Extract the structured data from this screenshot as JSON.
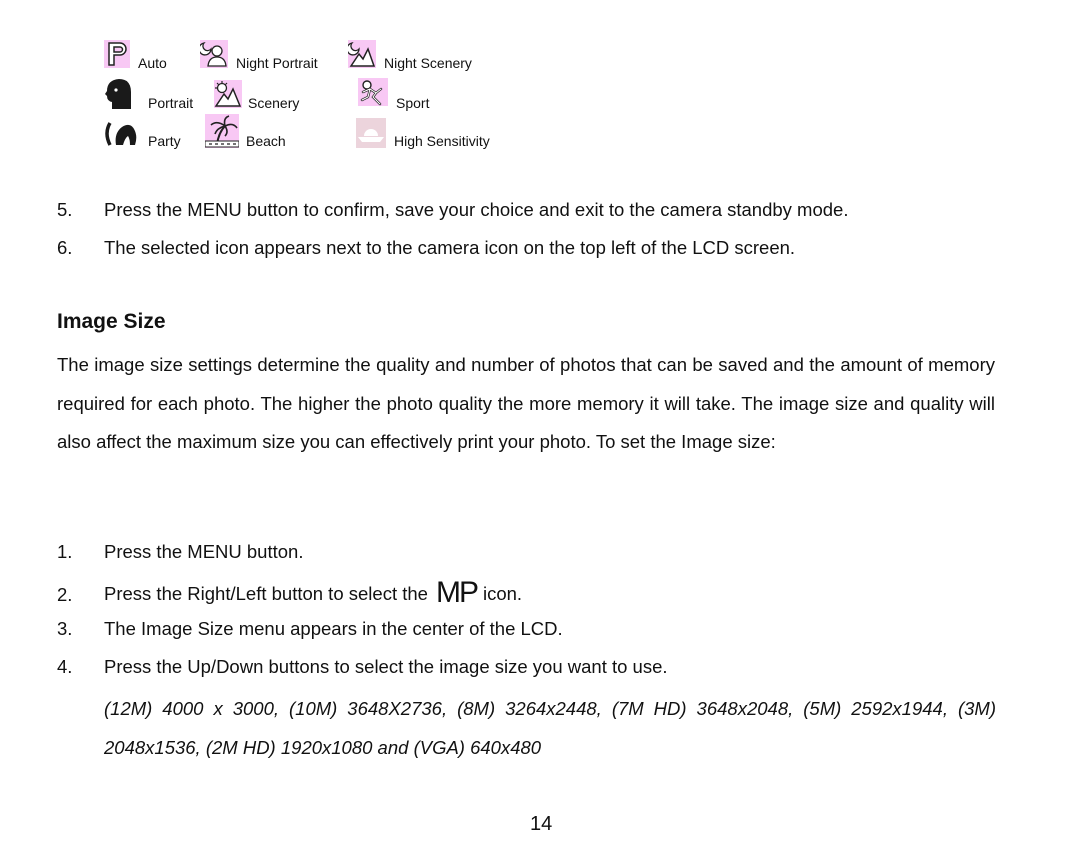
{
  "scene_modes": [
    {
      "label": "Auto",
      "icon": "auto-p-icon"
    },
    {
      "label": "Night Portrait",
      "icon": "night-portrait-icon"
    },
    {
      "label": "Night Scenery",
      "icon": "night-scenery-icon"
    },
    {
      "label": "Portrait",
      "icon": "portrait-icon"
    },
    {
      "label": "Scenery",
      "icon": "scenery-icon"
    },
    {
      "label": "Sport",
      "icon": "sport-icon"
    },
    {
      "label": "Party",
      "icon": "party-icon"
    },
    {
      "label": "Beach",
      "icon": "beach-icon"
    },
    {
      "label": "High Sensitivity",
      "icon": "high-sensitivity-icon"
    }
  ],
  "steps_continued": [
    {
      "num": "5.",
      "text": "Press the MENU button to confirm, save your choice and exit to the camera standby mode."
    },
    {
      "num": "6.",
      "text": "The selected icon appears next to the camera icon on the top left of the LCD screen."
    }
  ],
  "section": {
    "heading": "Image Size",
    "intro": "The image size settings determine the quality and number of photos that can be saved and the amount of memory required for each photo. The higher the photo quality the more memory it will take. The image size and quality will also affect the maximum size you can effectively print your photo. To set the Image size:",
    "steps": [
      {
        "num": "1.",
        "text": "Press the MENU button."
      },
      {
        "num": "2.",
        "text_before": "Press the Right/Left button to select the",
        "icon_text": "MP",
        "text_after": "icon."
      },
      {
        "num": "3.",
        "text": "The Image Size menu appears in the center of the LCD."
      },
      {
        "num": "4.",
        "text": "Press the Up/Down buttons to select the image size you want to use."
      }
    ],
    "sizes_text": "(12M) 4000 x 3000, (10M) 3648X2736, (8M) 3264x2448, (7M HD) 3648x2048, (5M) 2592x1944, (3M) 2048x1536, (2M HD) 1920x1080 and (VGA) 640x480"
  },
  "page_number": "14",
  "colors": {
    "icon_bg_pink": "#f8c8f4",
    "icon_bg_pale": "#ecd4dc"
  }
}
